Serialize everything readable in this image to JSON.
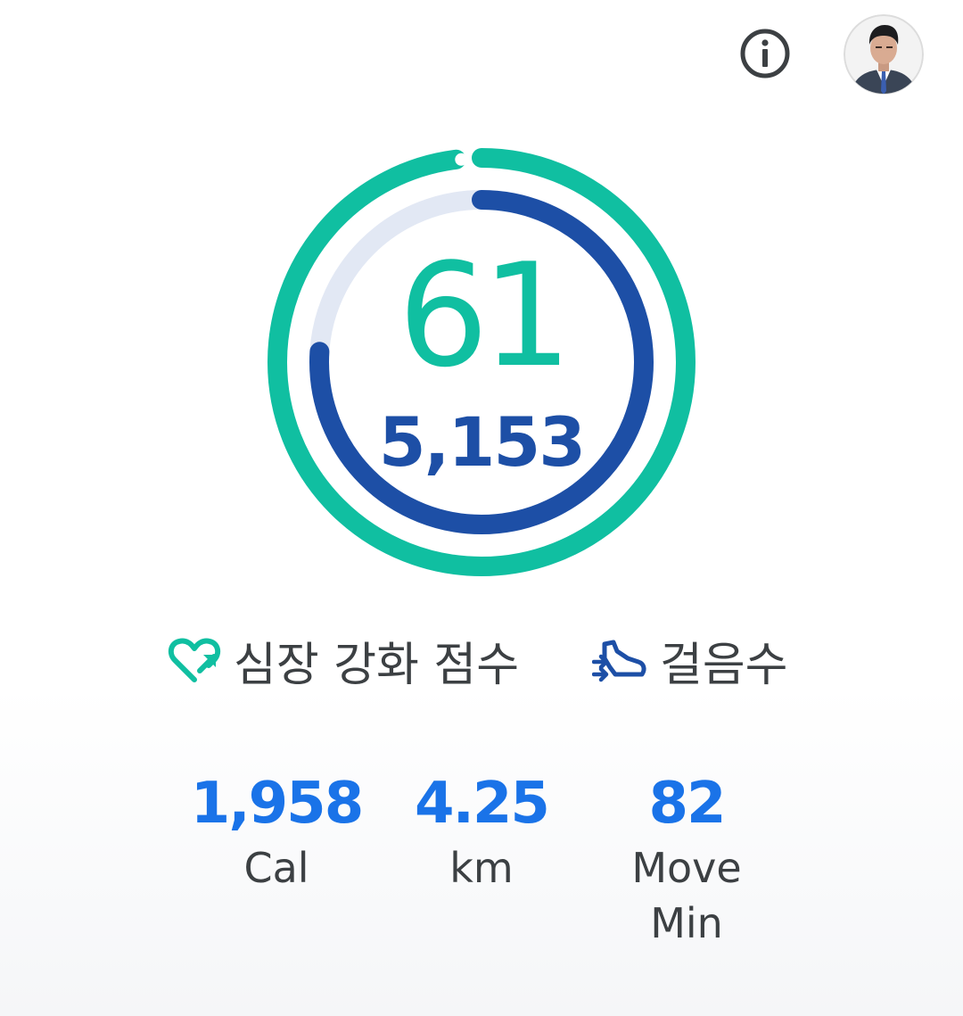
{
  "header": {
    "info_icon": "info-icon",
    "avatar_icon": "profile-avatar"
  },
  "rings": {
    "heart_points": "61",
    "steps": "5,153",
    "heart_points_goal_fraction": 0.98,
    "steps_goal_fraction": 0.76,
    "colors": {
      "heart": "#10bfa1",
      "steps": "#1d4fa6",
      "steps_track": "#e2e8f4"
    }
  },
  "legend": {
    "heart_label": "심장 강화 점수",
    "steps_label": "걸음수"
  },
  "stats": [
    {
      "value": "1,958",
      "label": "Cal"
    },
    {
      "value": "4.25",
      "label": "km"
    },
    {
      "value": "82",
      "label": "Move Min"
    }
  ],
  "colors": {
    "stat_value": "#1a73e8",
    "label_text": "#3c4043"
  }
}
